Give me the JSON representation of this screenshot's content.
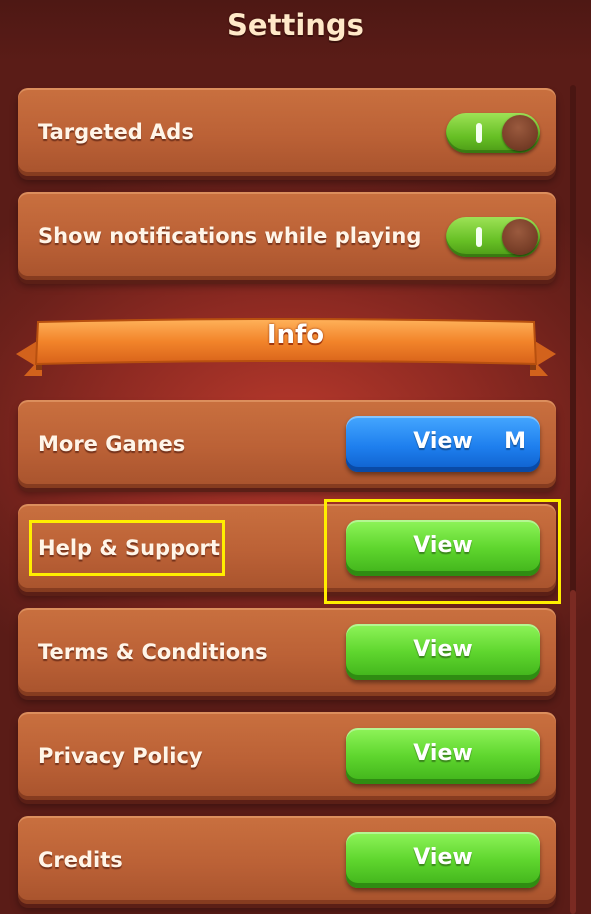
{
  "header": {
    "title": "Settings"
  },
  "toggles": [
    {
      "label": "Targeted Ads",
      "on": true
    },
    {
      "label": "Show notifications while playing",
      "on": true
    }
  ],
  "info_section": {
    "title": "Info",
    "items": [
      {
        "label": "More Games",
        "button_label": "View",
        "button_style": "blue",
        "button_icon": "M"
      },
      {
        "label": "Help & Support",
        "button_label": "View",
        "button_style": "green"
      },
      {
        "label": "Terms & Conditions",
        "button_label": "View",
        "button_style": "green"
      },
      {
        "label": "Privacy Policy",
        "button_label": "View",
        "button_style": "green"
      },
      {
        "label": "Credits",
        "button_label": "View",
        "button_style": "green"
      }
    ]
  },
  "colors": {
    "background": "#8e2a22",
    "panel": "#bb6136",
    "toggle_on": "#66bf24",
    "button_green": "#5fd62e",
    "button_blue": "#1e7fee",
    "ribbon": "#f08a2e",
    "highlight": "#ffee00"
  }
}
